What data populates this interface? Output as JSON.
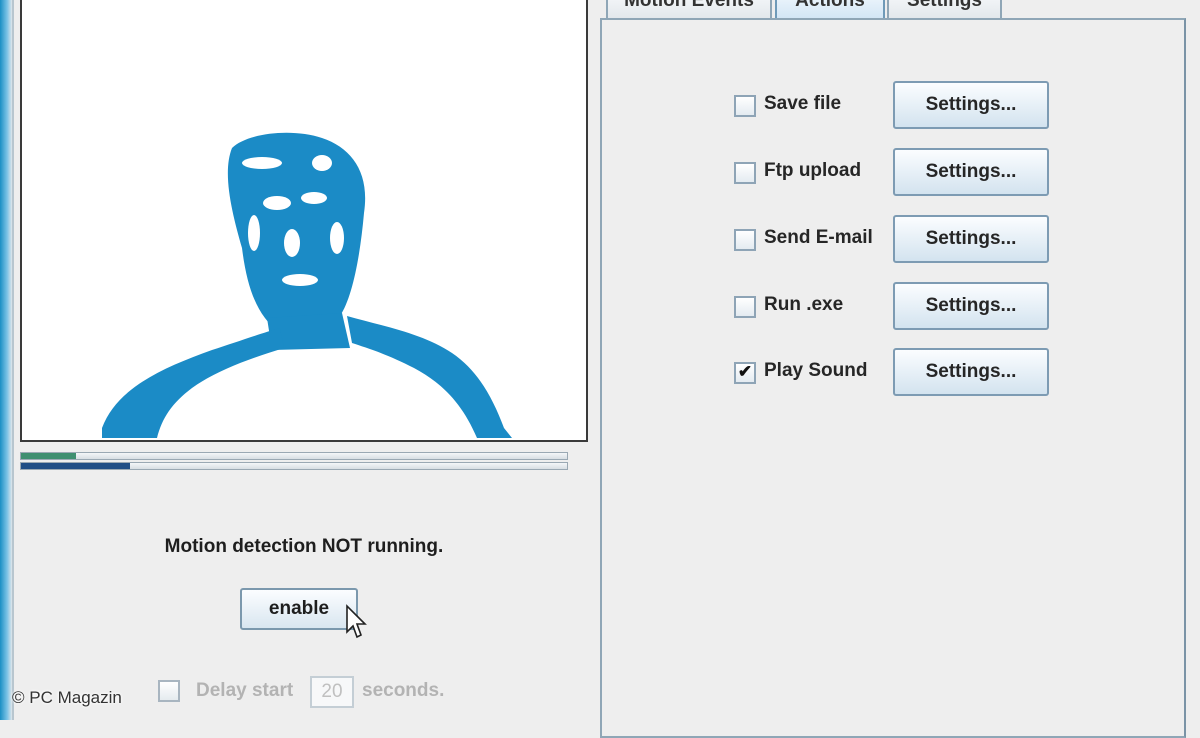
{
  "tabs": [
    {
      "label": "Motion Events",
      "selected": false
    },
    {
      "label": "Actions",
      "selected": true
    },
    {
      "label": "Settings",
      "selected": false
    }
  ],
  "preview": {
    "motion_level": 0.1,
    "threshold_level": 0.2,
    "silhouette_color": "#1b8bc6"
  },
  "status": {
    "text": "Motion detection NOT running."
  },
  "enable_button": {
    "label": "enable"
  },
  "delay": {
    "checked": false,
    "label": "Delay start",
    "value": "20",
    "unit": "seconds."
  },
  "actions": [
    {
      "label": "Save file",
      "checked": false,
      "button": "Settings..."
    },
    {
      "label": "Ftp upload",
      "checked": false,
      "button": "Settings..."
    },
    {
      "label": "Send E-mail",
      "checked": false,
      "button": "Settings..."
    },
    {
      "label": "Run .exe",
      "checked": false,
      "button": "Settings..."
    },
    {
      "label": "Play Sound",
      "checked": true,
      "button": "Settings..."
    }
  ],
  "checkmark_glyph": "✔",
  "watermark": "© PC Magazin"
}
